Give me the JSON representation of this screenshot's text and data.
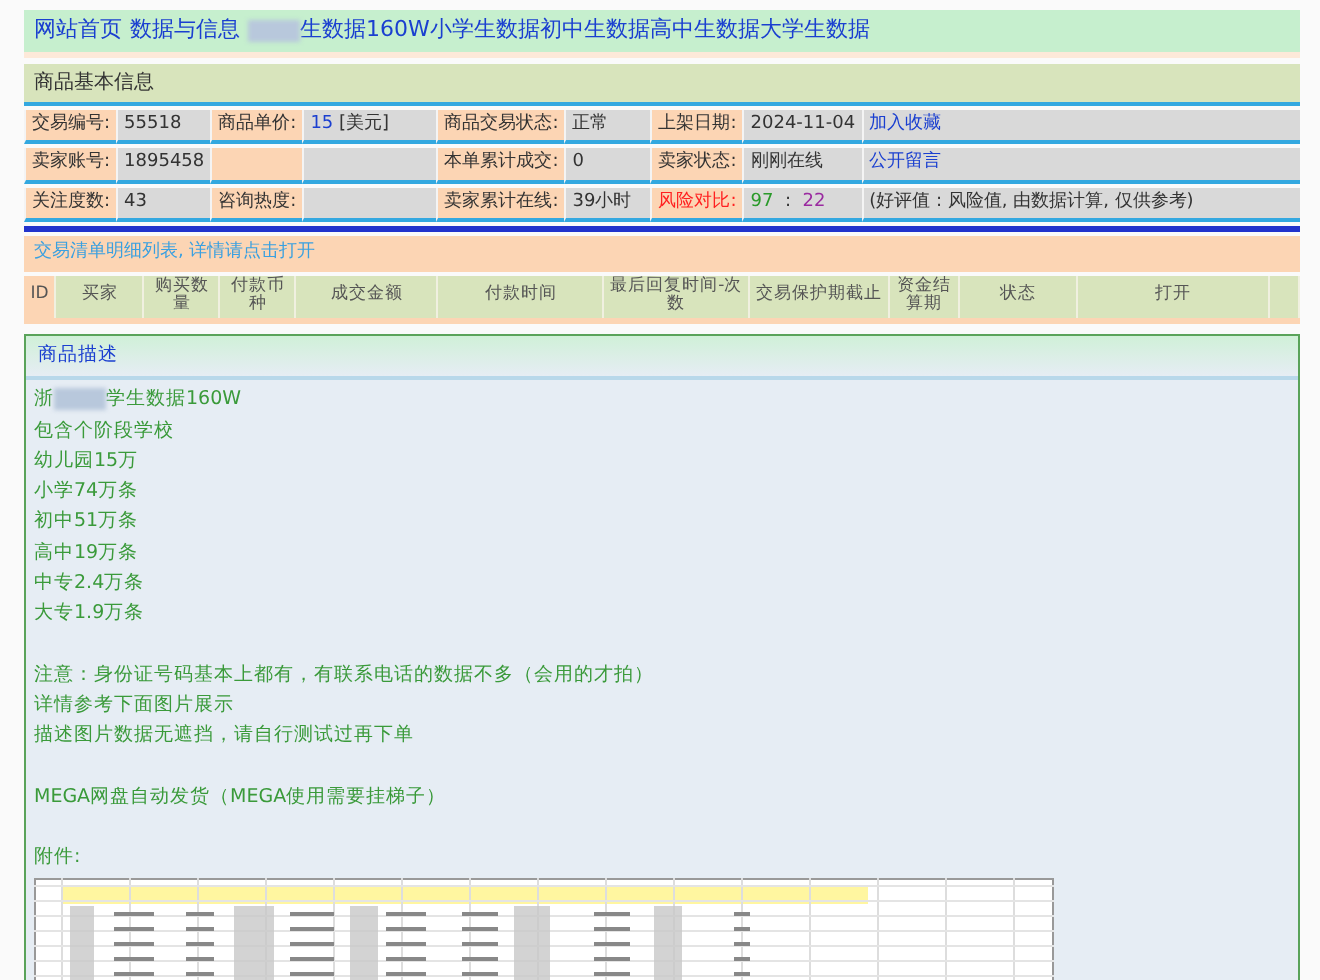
{
  "breadcrumb": {
    "links": [
      {
        "text": "网站首页"
      },
      {
        "text": "数据与信息"
      }
    ],
    "redacted": true,
    "title": "生数据160W小学生数据初中生数据高中生数据大学生数据"
  },
  "basic_info": {
    "header": "商品基本信息",
    "rows": [
      [
        {
          "kind": "label",
          "text": "交易编号:"
        },
        {
          "kind": "value",
          "text": "55518"
        },
        {
          "kind": "label",
          "text": "商品单价:"
        },
        {
          "kind": "price",
          "text": "15",
          "unit": "[美元]"
        },
        {
          "kind": "label",
          "text": "商品交易状态:"
        },
        {
          "kind": "value",
          "text": "正常"
        },
        {
          "kind": "label",
          "text": "上架日期:"
        },
        {
          "kind": "value",
          "text": "2024-11-04"
        },
        {
          "kind": "link",
          "text": "加入收藏"
        }
      ],
      [
        {
          "kind": "label",
          "text": "卖家账号:"
        },
        {
          "kind": "value",
          "text": "1895458"
        },
        {
          "kind": "label"
        },
        {
          "kind": "value"
        },
        {
          "kind": "label",
          "text": "本单累计成交:"
        },
        {
          "kind": "value",
          "text": "0"
        },
        {
          "kind": "label",
          "text": "卖家状态:"
        },
        {
          "kind": "value",
          "text": "刚刚在线"
        },
        {
          "kind": "link",
          "text": "公开留言"
        }
      ],
      [
        {
          "kind": "label",
          "text": "关注度数:"
        },
        {
          "kind": "value",
          "text": "43"
        },
        {
          "kind": "label",
          "text": "咨询热度:"
        },
        {
          "kind": "value"
        },
        {
          "kind": "label",
          "text": "卖家累计在线:"
        },
        {
          "kind": "value",
          "text": "39小时"
        },
        {
          "kind": "alert",
          "text": "风险对比:"
        },
        {
          "kind": "score",
          "good": "97",
          "separator": ":",
          "bad": "22"
        },
        {
          "kind": "value",
          "text": "(好评值 : 风险值, 由数据计算, 仅供参考)"
        }
      ]
    ]
  },
  "orders": {
    "title": "交易清单明细列表, 详情请点击打开",
    "columns": [
      "ID",
      "买家",
      "购买数量",
      "付款币种",
      "成交金额",
      "付款时间",
      "最后回复时间-次数",
      "交易保护期截止",
      "资金结算期",
      "状态",
      "打开"
    ]
  },
  "description": {
    "title": "商品描述",
    "first_line": {
      "before": "浙",
      "after": "学生数据160W",
      "redacted": true
    },
    "paragraphs": [
      [
        "包含个阶段学校",
        "幼儿园15万",
        "小学74万条",
        "初中51万条",
        "高中19万条",
        "中专2.4万条",
        "大专1.9万条"
      ],
      [
        "注意：身份证号码基本上都有，有联系电话的数据不多（会用的才拍）",
        "详情参考下面图片展示",
        "描述图片数据无遮挡，请自行测试过再下单"
      ],
      [
        "MEGA网盘自动发货（MEGA使用需要挂梯子）"
      ]
    ],
    "attachment_label": "附件:"
  }
}
